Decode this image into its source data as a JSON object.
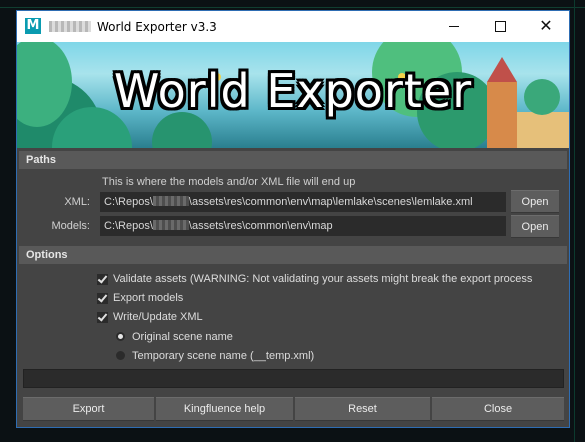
{
  "window": {
    "title": "World Exporter v3.3",
    "logo_letter": "M"
  },
  "banner": {
    "title": "World Exporter"
  },
  "paths": {
    "header": "Paths",
    "info": "This is where the models and/or XML file will end up",
    "xml_label": "XML:",
    "xml_prefix": "C:\\Repos\\",
    "xml_suffix": "\\assets\\res\\common\\env\\map\\lemlake\\scenes\\lemlake.xml",
    "models_label": "Models:",
    "models_prefix": "C:\\Repos\\",
    "models_suffix": "\\assets\\res\\common\\env\\map",
    "open_label": "Open"
  },
  "options": {
    "header": "Options",
    "validate": "Validate assets (WARNING: Not validating your assets might break the export process",
    "export_models": "Export models",
    "write_xml": "Write/Update XML",
    "original_scene": "Original scene name",
    "temporary_scene": "Temporary scene name (__temp.xml)"
  },
  "progress": {
    "value": 0
  },
  "buttons": {
    "export": "Export",
    "help": "Kingfluence help",
    "reset": "Reset",
    "close": "Close"
  }
}
